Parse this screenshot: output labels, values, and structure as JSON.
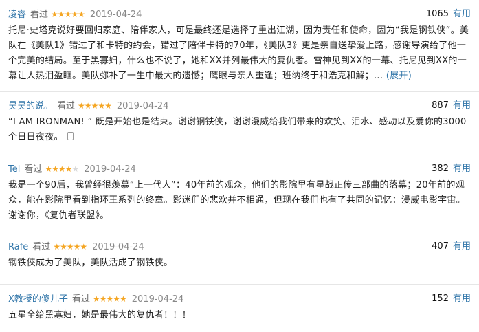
{
  "reviews": [
    {
      "user": "凌睿",
      "watched": "看过",
      "rating": 5,
      "date": "2019-04-24",
      "votes": "1065",
      "useful": "有用",
      "text": "托尼·史塔克说好要回归家庭、陪伴家人，可是最终还是选择了重出江湖，因为责任和使命，因为“我是钢铁侠”。美队在《美队1》错过了和卡特的约会，错过了陪伴卡特的70年，《美队3》更是亲自送挚爱上路，感谢导演给了他一个完美的结局。至于黑寡妇，什么也不说了，她和XX并列最伟大的复仇者。雷神见到XX的一幕、托尼见到XX的一幕让人热泪盈眶。美队弥补了一生中最大的遗憾；鹰眼与亲人重逢；班纳终于和浩克和解；...",
      "expand": "(展开)"
    },
    {
      "user": "昊昊的说。",
      "watched": "看过",
      "rating": 5,
      "date": "2019-04-24",
      "votes": "887",
      "useful": "有用",
      "text": "“I AM IRONMAN! ” 既是开始也是结束。谢谢钢铁侠，谢谢漫威给我们带来的欢笑、泪水、感动以及爱你的3000个日日夜夜。"
    },
    {
      "user": "Tel",
      "watched": "看过",
      "rating": 4,
      "date": "2019-04-24",
      "votes": "382",
      "useful": "有用",
      "text": "我是一个90后，我曾经很羡慕“上一代人”：40年前的观众，他们的影院里有星战正传三部曲的落幕；20年前的观众，能在影院里看到指环王系列的终章。影迷们的悲欢并不相通，但现在我们也有了共同的记忆：漫威电影宇宙。谢谢你，《复仇者联盟》。"
    },
    {
      "user": "Rafe",
      "watched": "看过",
      "rating": 5,
      "date": "2019-04-24",
      "votes": "407",
      "useful": "有用",
      "text": "钢铁侠成为了美队，美队活成了钢铁侠。"
    },
    {
      "user": "X教授的傻儿子",
      "watched": "看过",
      "rating": 5,
      "date": "2019-04-24",
      "votes": "152",
      "useful": "有用",
      "text": "五星全给黑寡妇，她是最伟大的复仇者！！！"
    }
  ],
  "colors": {
    "link": "#3377aa",
    "star": "#f5a623",
    "date": "#888888",
    "divider": "#e6e6e6"
  }
}
